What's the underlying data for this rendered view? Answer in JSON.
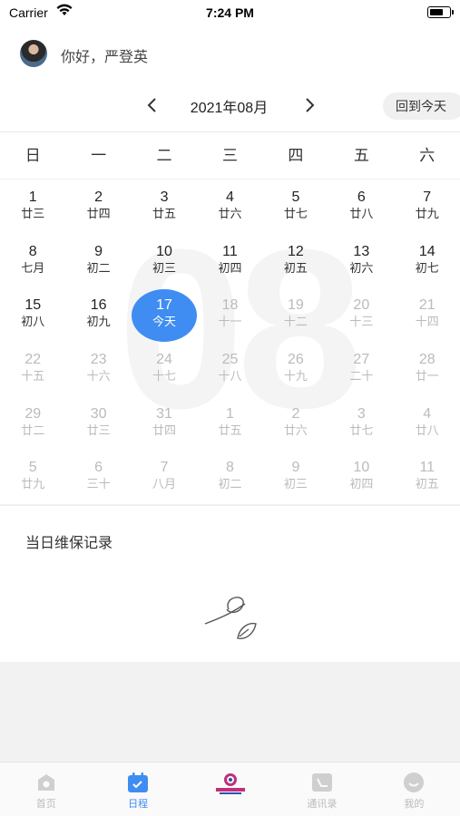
{
  "status_bar": {
    "carrier": "Carrier",
    "time": "7:24 PM"
  },
  "header": {
    "greeting": "你好，严登英"
  },
  "calendar": {
    "month_title": "2021年08月",
    "today_button": "回到今天",
    "watermark": "08",
    "weekdays": [
      "日",
      "一",
      "二",
      "三",
      "四",
      "五",
      "六"
    ],
    "rows": [
      [
        {
          "n": "1",
          "l": "廿三"
        },
        {
          "n": "2",
          "l": "廿四"
        },
        {
          "n": "3",
          "l": "廿五"
        },
        {
          "n": "4",
          "l": "廿六"
        },
        {
          "n": "5",
          "l": "廿七"
        },
        {
          "n": "6",
          "l": "廿八"
        },
        {
          "n": "7",
          "l": "廿九"
        }
      ],
      [
        {
          "n": "8",
          "l": "七月"
        },
        {
          "n": "9",
          "l": "初二"
        },
        {
          "n": "10",
          "l": "初三"
        },
        {
          "n": "11",
          "l": "初四"
        },
        {
          "n": "12",
          "l": "初五"
        },
        {
          "n": "13",
          "l": "初六"
        },
        {
          "n": "14",
          "l": "初七"
        }
      ],
      [
        {
          "n": "15",
          "l": "初八"
        },
        {
          "n": "16",
          "l": "初九"
        },
        {
          "n": "17",
          "l": "今天",
          "today": true
        },
        {
          "n": "18",
          "l": "十一",
          "dim": true
        },
        {
          "n": "19",
          "l": "十二",
          "dim": true
        },
        {
          "n": "20",
          "l": "十三",
          "dim": true
        },
        {
          "n": "21",
          "l": "十四",
          "dim": true
        }
      ],
      [
        {
          "n": "22",
          "l": "十五",
          "dim": true
        },
        {
          "n": "23",
          "l": "十六",
          "dim": true
        },
        {
          "n": "24",
          "l": "十七",
          "dim": true
        },
        {
          "n": "25",
          "l": "十八",
          "dim": true
        },
        {
          "n": "26",
          "l": "十九",
          "dim": true
        },
        {
          "n": "27",
          "l": "二十",
          "dim": true
        },
        {
          "n": "28",
          "l": "廿一",
          "dim": true
        }
      ],
      [
        {
          "n": "29",
          "l": "廿二",
          "dim": true
        },
        {
          "n": "30",
          "l": "廿三",
          "dim": true
        },
        {
          "n": "31",
          "l": "廿四",
          "dim": true
        },
        {
          "n": "1",
          "l": "廿五",
          "dim": true
        },
        {
          "n": "2",
          "l": "廿六",
          "dim": true
        },
        {
          "n": "3",
          "l": "廿七",
          "dim": true
        },
        {
          "n": "4",
          "l": "廿八",
          "dim": true
        }
      ],
      [
        {
          "n": "5",
          "l": "廿九",
          "dim": true
        },
        {
          "n": "6",
          "l": "三十",
          "dim": true
        },
        {
          "n": "7",
          "l": "八月",
          "dim": true
        },
        {
          "n": "8",
          "l": "初二",
          "dim": true
        },
        {
          "n": "9",
          "l": "初三",
          "dim": true
        },
        {
          "n": "10",
          "l": "初四",
          "dim": true
        },
        {
          "n": "11",
          "l": "初五",
          "dim": true
        }
      ]
    ]
  },
  "records": {
    "title": "当日维保记录"
  },
  "tabbar": {
    "items": [
      {
        "label": "首页",
        "icon": "home-icon"
      },
      {
        "label": "日程",
        "icon": "calendar-icon",
        "active": true
      },
      {
        "label": "",
        "icon": "brand-logo-icon"
      },
      {
        "label": "通讯录",
        "icon": "contacts-icon"
      },
      {
        "label": "我的",
        "icon": "profile-icon"
      }
    ]
  },
  "colors": {
    "accent": "#3f8df2",
    "dim_text": "#bbbbbb",
    "background": "#f2f2f2"
  }
}
